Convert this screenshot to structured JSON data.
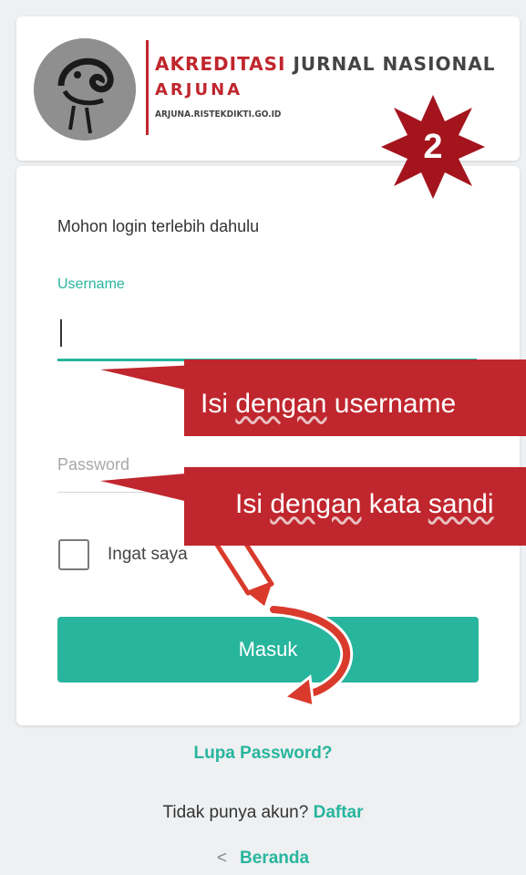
{
  "header": {
    "brand_title_red": "AKREDITASI",
    "brand_title_rest": " JURNAL NASIONAL",
    "brand_subtitle": "ARJUNA",
    "brand_url": "ARJUNA.RISTEKDIKTI.GO.ID",
    "step_number": "2"
  },
  "form": {
    "intro": "Mohon login terlebih dahulu",
    "username_label": "Username",
    "username_value": "",
    "password_placeholder": "Password",
    "remember_label": "Ingat saya",
    "remember_checked": false,
    "submit_label": "Masuk"
  },
  "callouts": {
    "username_prefix": "Isi ",
    "username_wavy": "dengan",
    "username_suffix": " username",
    "password_prefix": "Isi ",
    "password_wavy": "dengan",
    "password_mid": " kata ",
    "password_wavy2": "sandi"
  },
  "footer": {
    "forgot_password": "Lupa Password?",
    "no_account_text": "Tidak punya akun? ",
    "signup_link": "Daftar",
    "home_chevron": "<",
    "home_link": "Beranda"
  },
  "colors": {
    "accent": "#27b59d",
    "brand_red": "#c0262d",
    "background": "#eef0f2"
  }
}
